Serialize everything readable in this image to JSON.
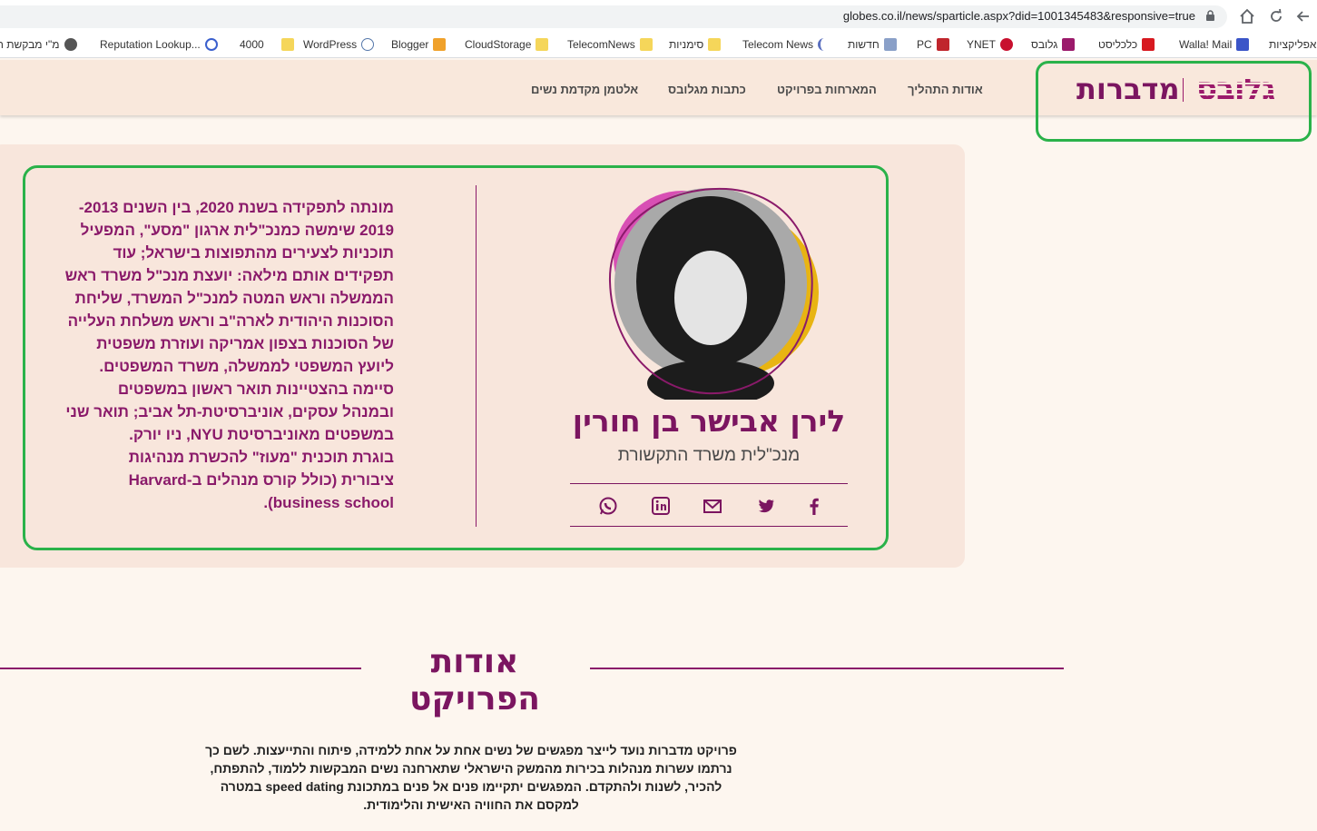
{
  "browser": {
    "url": "globes.co.il/news/sparticle.aspx?did=1001345483&responsive=true",
    "icons": [
      "lock-icon",
      "home-icon",
      "reload-icon",
      "back-icon"
    ]
  },
  "bookmarks": [
    {
      "label": "מ\"י מבקשת ח",
      "icon": "globe-icon"
    },
    {
      "label": "Reputation Lookup...",
      "icon": "ring-icon"
    },
    {
      "label": "4000",
      "icon": "folder-icon"
    },
    {
      "label": "WordPress",
      "icon": "wordpress-icon"
    },
    {
      "label": "Blogger",
      "icon": "blogger-icon"
    },
    {
      "label": "CloudStorage",
      "icon": "folder-icon"
    },
    {
      "label": "TelecomNews",
      "icon": "folder-icon"
    },
    {
      "label": "סימניות",
      "icon": "folder-icon"
    },
    {
      "label": "Telecom News",
      "icon": "crescent-icon"
    },
    {
      "label": "חדשות",
      "icon": "news-icon"
    },
    {
      "label": "PC",
      "icon": "pc-icon"
    },
    {
      "label": "YNET",
      "icon": "ynet-icon"
    },
    {
      "label": "גלובס",
      "icon": "globes-icon"
    },
    {
      "label": "כלכליסט",
      "icon": "calcalist-icon"
    },
    {
      "label": "Walla! Mail",
      "icon": "walla-icon"
    },
    {
      "label": "אפליקציות",
      "icon": "apps-icon"
    }
  ],
  "header": {
    "logo_globes": "גלובס",
    "logo_medabrot": "מדברות",
    "nav": [
      "אודות התהליך",
      "המארחות בפרויקט",
      "כתבות מגלובס",
      "אלטמן מקדמת נשים"
    ]
  },
  "profile": {
    "name": "לירן אבישר בן חורין",
    "role": "מנכ\"לית משרד התקשורת",
    "bio": [
      "מונתה לתפקידה בשנת 2020, בין השנים 2013-",
      "2019 שימשה כמנכ\"לית ארגון \"מסע\", המפעיל",
      "תוכניות לצעירים מהתפוצות בישראל; עוד",
      "תפקידים אותם מילאה: יועצת מנכ\"ל משרד ראש",
      "הממשלה וראש המטה למנכ\"ל המשרד, שליחת",
      "הסוכנות היהודית לארה\"ב וראש משלחת העלייה",
      "של הסוכנות בצפון אמריקה ועוזרת משפטית",
      "ליועץ המשפטי לממשלה, משרד המשפטים.",
      "סיימה בהצטיינות תואר ראשון במשפטים",
      "ובמנהל עסקים, אוניברסיטת-תל אביב; תואר שני",
      "במשפטים מאוניברסיטת NYU, ניו יורק.",
      "בוגרת תוכנית \"מעוז\" להכשרת מנהיגות",
      "ציבורית (כולל קורס מנהלים ב-Harvard",
      "business school)."
    ],
    "share_icons": [
      "facebook-icon",
      "twitter-icon",
      "email-icon",
      "linkedin-icon",
      "whatsapp-icon"
    ]
  },
  "about": {
    "title": "אודות הפרויקט",
    "lines": [
      "פרויקט מדברות נועד לייצר מפגשים של נשים אחת על אחת ללמידה, פיתוח והתייעצות. לשם כך",
      "נרתמו עשרות מנהלות בכירות מהמשק הישראלי שתארחנה נשים המבקשות ללמוד, להתפתח,",
      "להכיר, לשנות ולהתקדם. המפגשים יתקיימו פנים אל פנים במתכונת speed dating במטרה",
      "למקסם את החוויה האישית והלימודית."
    ]
  },
  "colors": {
    "brand": "#7b1560",
    "highlight": "#2ab24a",
    "card_bg": "#f8e6dc",
    "page_bg": "#fdf6ef"
  }
}
